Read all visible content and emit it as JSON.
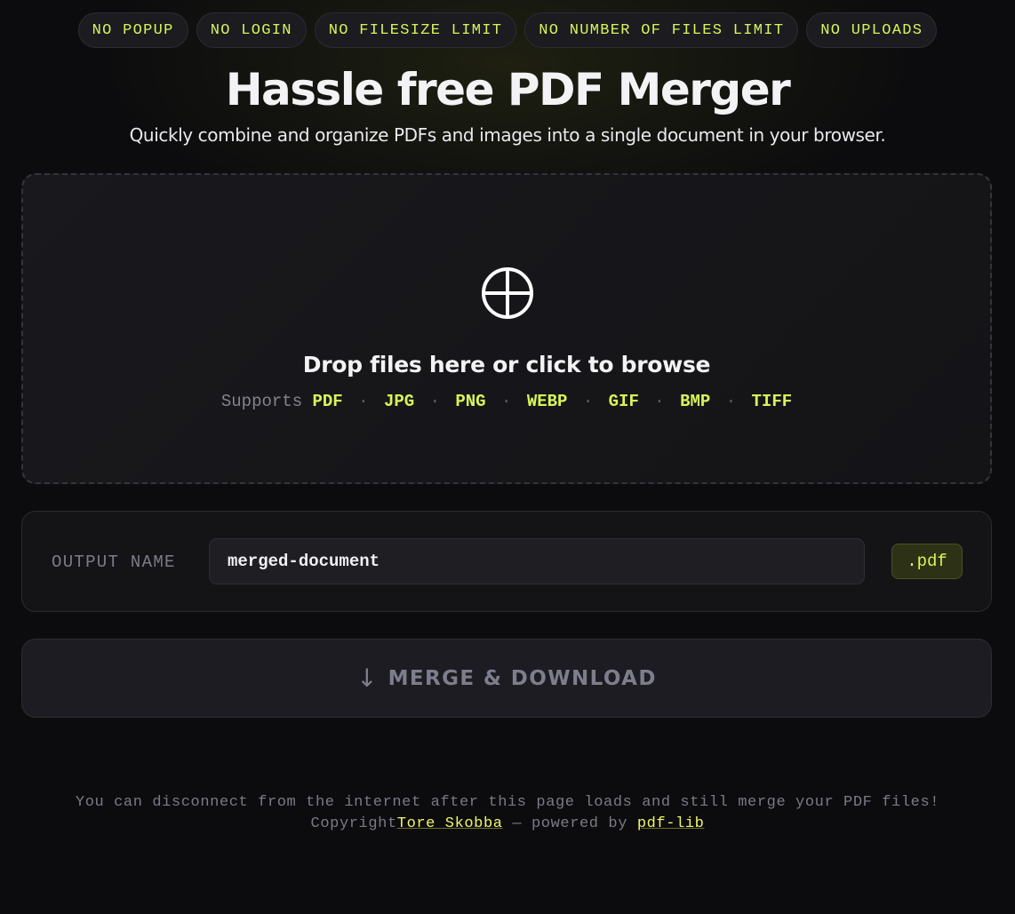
{
  "badges": [
    "NO POPUP",
    "NO LOGIN",
    "NO FILESIZE LIMIT",
    "NO NUMBER OF FILES LIMIT",
    "NO UPLOADS"
  ],
  "header": {
    "title": "Hassle free PDF Merger",
    "subtitle": "Quickly combine and organize PDFs and images into a single document in your browser."
  },
  "dropzone": {
    "icon": "crosshair-circle-icon",
    "title": "Drop files here or click to browse",
    "supports_label": "Supports",
    "formats": [
      "PDF",
      "JPG",
      "PNG",
      "WEBP",
      "GIF",
      "BMP",
      "TIFF"
    ],
    "separator": "·"
  },
  "output": {
    "label": "OUTPUT NAME",
    "value": "merged-document",
    "extension": ".pdf"
  },
  "merge_button": {
    "icon": "↓",
    "label": "MERGE & DOWNLOAD"
  },
  "footer": {
    "line1": "You can disconnect from the internet after this page loads and still merge your PDF files!",
    "copyright_prefix": "Copyright",
    "author_link": "Tore Skobba",
    "powered_by": " — powered by ",
    "library_link": "pdf-lib"
  },
  "colors": {
    "accent": "#d8f558",
    "background": "#0c0c0e",
    "card": "#141417",
    "muted_text": "#7a7a86"
  }
}
